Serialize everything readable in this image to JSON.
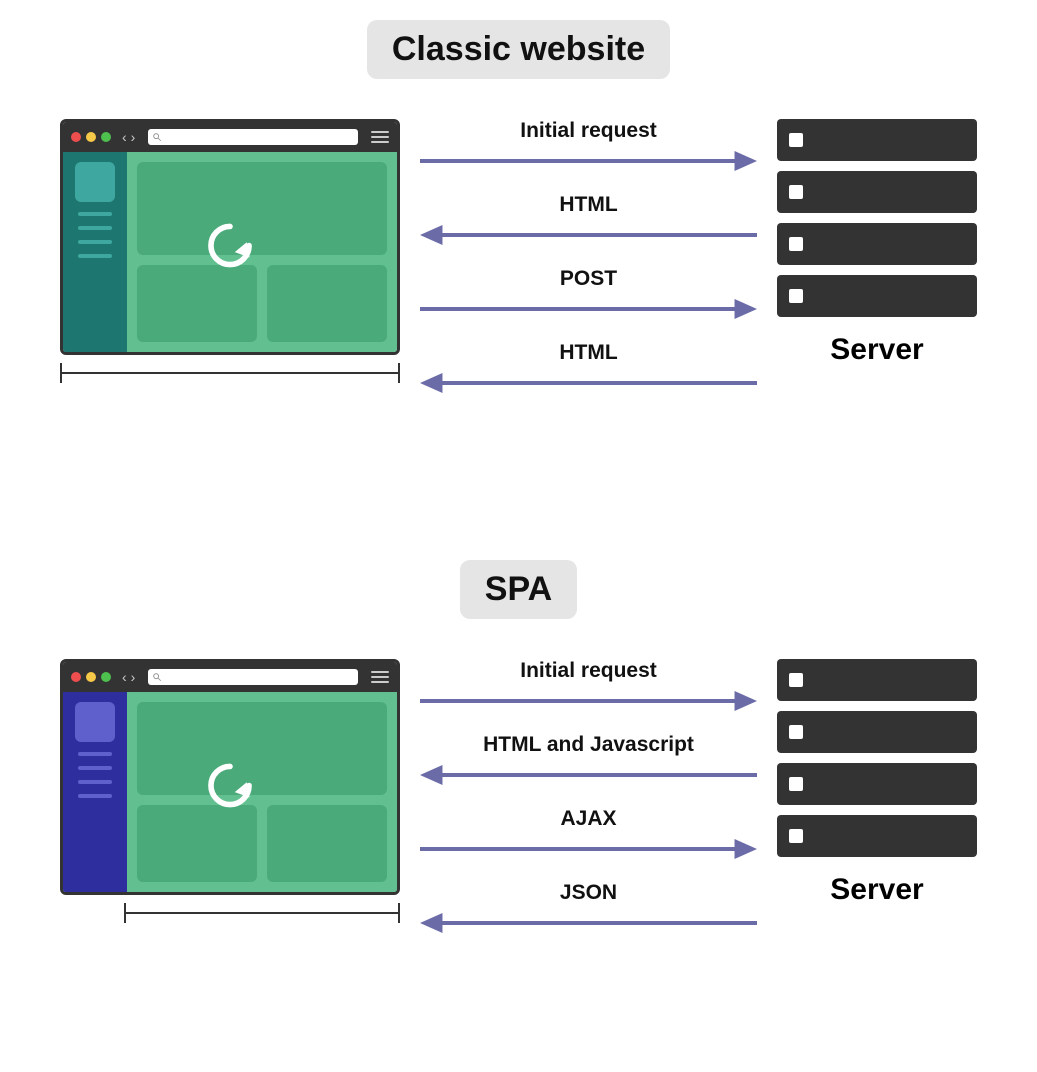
{
  "diagrams": {
    "classic": {
      "title": "Classic website",
      "arrows": [
        {
          "label": "Initial request",
          "direction": "right"
        },
        {
          "label": "HTML",
          "direction": "left"
        },
        {
          "label": "POST",
          "direction": "right"
        },
        {
          "label": "HTML",
          "direction": "left"
        }
      ],
      "server_label": "Server",
      "bracket": "full",
      "sidebar_color": "teal"
    },
    "spa": {
      "title": "SPA",
      "arrows": [
        {
          "label": "Initial request",
          "direction": "right"
        },
        {
          "label": "HTML and Javascript",
          "direction": "left"
        },
        {
          "label": "AJAX",
          "direction": "right"
        },
        {
          "label": "JSON",
          "direction": "left"
        }
      ],
      "server_label": "Server",
      "bracket": "partial",
      "sidebar_color": "indigo"
    }
  },
  "colors": {
    "arrow": "#6b6ba8",
    "content_bg": "#62c090",
    "panel_bg": "#4aaa7a",
    "sidebar_teal": "#1d766f",
    "sidebar_indigo": "#2e2e9e"
  }
}
